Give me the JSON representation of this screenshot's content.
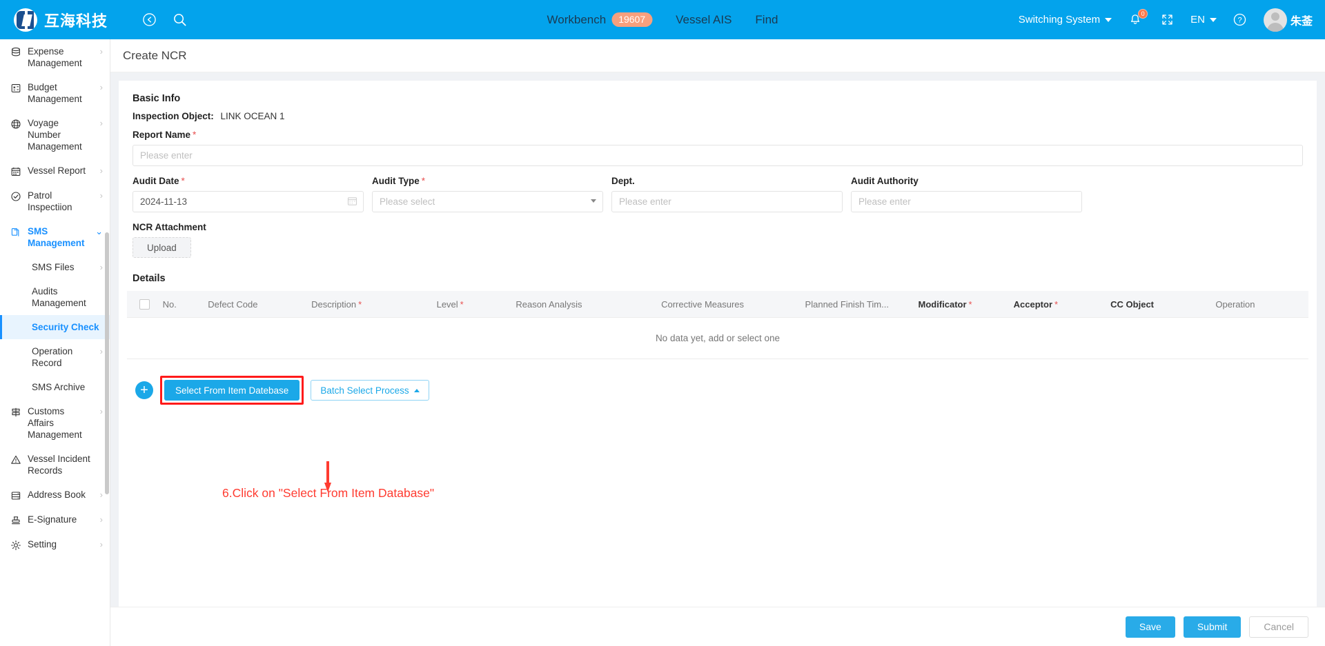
{
  "header": {
    "brand_name": "互海科技",
    "back_icon": "back-arrow-icon",
    "search_icon": "search-icon",
    "nav": [
      {
        "label": "Workbench",
        "badge": "19607"
      },
      {
        "label": "Vessel AIS",
        "badge": ""
      },
      {
        "label": "Find",
        "badge": ""
      }
    ],
    "switching_system": "Switching System",
    "notification_count": "0",
    "fullscreen_icon": "expand-icon",
    "language": "EN",
    "help_icon": "question-circle-icon",
    "user_name": "朱菳"
  },
  "sidebar": {
    "items": [
      {
        "label": "Expense Management",
        "icon": "database-icon",
        "arrow": "›",
        "type": "item"
      },
      {
        "label": "Budget Management",
        "icon": "budget-icon",
        "arrow": "›",
        "type": "item"
      },
      {
        "label": "Voyage Number Management",
        "icon": "globe-icon",
        "arrow": "›",
        "type": "item"
      },
      {
        "label": "Vessel Report",
        "icon": "calendar-icon",
        "arrow": "›",
        "type": "item"
      },
      {
        "label": "Patrol Inspectiion",
        "icon": "check-circle-icon",
        "arrow": "›",
        "type": "item"
      },
      {
        "label": "SMS Management",
        "icon": "files-icon",
        "arrow": "⌄",
        "type": "expanded"
      },
      {
        "label": "SMS Files",
        "icon": "",
        "arrow": "›",
        "type": "sub"
      },
      {
        "label": "Audits Management",
        "icon": "",
        "arrow": "",
        "type": "sub"
      },
      {
        "label": "Security Check",
        "icon": "",
        "arrow": "",
        "type": "sub-selected"
      },
      {
        "label": "Operation Record",
        "icon": "",
        "arrow": "›",
        "type": "sub"
      },
      {
        "label": "SMS Archive",
        "icon": "",
        "arrow": "",
        "type": "sub"
      },
      {
        "label": "Customs Affairs Management",
        "icon": "signpost-icon",
        "arrow": "›",
        "type": "item"
      },
      {
        "label": "Vessel Incident Records",
        "icon": "warning-triangle-icon",
        "arrow": "",
        "type": "item"
      },
      {
        "label": "Address Book",
        "icon": "address-book-icon",
        "arrow": "›",
        "type": "item"
      },
      {
        "label": "E-Signature",
        "icon": "stamp-icon",
        "arrow": "›",
        "type": "item"
      },
      {
        "label": "Setting",
        "icon": "gear-icon",
        "arrow": "›",
        "type": "item"
      }
    ]
  },
  "page": {
    "title": "Create NCR"
  },
  "basic_info": {
    "section_title": "Basic Info",
    "inspection_object_label": "Inspection Object:",
    "inspection_object_value": "LINK OCEAN 1",
    "report_name_label": "Report Name",
    "report_name_placeholder": "Please enter",
    "report_name_value": "",
    "audit_date_label": "Audit Date",
    "audit_date_value": "2024-11-13",
    "audit_type_label": "Audit Type",
    "audit_type_placeholder": "Please select",
    "dept_label": "Dept.",
    "dept_placeholder": "Please enter",
    "audit_authority_label": "Audit Authority",
    "audit_authority_placeholder": "Please enter",
    "ncr_attachment_label": "NCR Attachment",
    "upload_label": "Upload"
  },
  "details": {
    "section_title": "Details",
    "columns": [
      {
        "label": "No.",
        "required": false,
        "bold": false
      },
      {
        "label": "Defect Code",
        "required": false,
        "bold": false
      },
      {
        "label": "Description",
        "required": true,
        "bold": false
      },
      {
        "label": "Level",
        "required": true,
        "bold": false
      },
      {
        "label": "Reason Analysis",
        "required": false,
        "bold": false
      },
      {
        "label": "Corrective Measures",
        "required": false,
        "bold": false
      },
      {
        "label": "Planned Finish Tim...",
        "required": false,
        "bold": false
      },
      {
        "label": "Modificator",
        "required": true,
        "bold": true
      },
      {
        "label": "Acceptor",
        "required": true,
        "bold": true
      },
      {
        "label": "CC Object",
        "required": false,
        "bold": true
      },
      {
        "label": "Operation",
        "required": false,
        "bold": false
      }
    ],
    "empty_text": "No data yet, add or select one",
    "add_button": "+",
    "select_from_item_database": "Select From Item Datebase",
    "batch_select_process": "Batch Select Process"
  },
  "annotation": {
    "text": "6.Click on \"Select From Item Database\"",
    "color": "#ff3b30"
  },
  "footer": {
    "save": "Save",
    "submit": "Submit",
    "cancel": "Cancel"
  },
  "colors": {
    "brand_blue": "#03a3ec",
    "accent": "#1ba8e8",
    "required_red": "#e85050",
    "annotation_red": "#ff3b30",
    "badge_orange": "#f7a07e",
    "selected_bg": "#e8f4fe"
  }
}
